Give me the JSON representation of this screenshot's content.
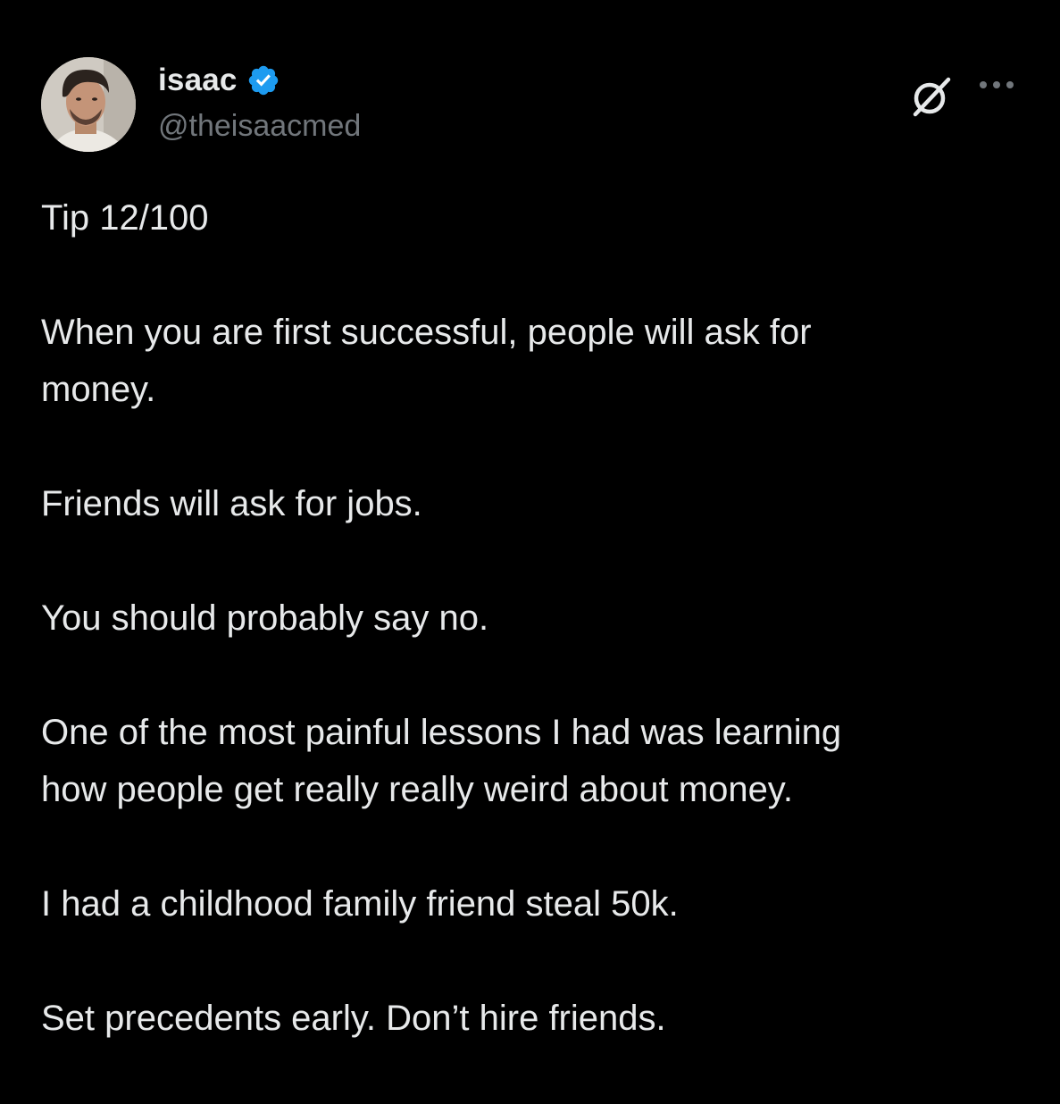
{
  "post": {
    "author": {
      "display_name": "isaac",
      "handle": "@theisaacmed",
      "verified": true,
      "verified_color": "#1d9bf0"
    },
    "icons": {
      "avatar": "profile-photo",
      "grok": "grok-icon",
      "more": "more-dots-icon"
    },
    "paragraphs": [
      "Tip 12/100",
      "When you are first successful, people will ask for\nmoney.",
      "Friends will ask for jobs.",
      "You should probably say no.",
      "One of the most painful lessons I had was learning\nhow people get really really weird about money.",
      "I had a childhood family friend steal 50k.",
      "Set precedents early. Don’t hire friends."
    ]
  },
  "theme": {
    "background": "#000000",
    "text": "#e7e9ea",
    "secondary_text": "#71767b"
  }
}
